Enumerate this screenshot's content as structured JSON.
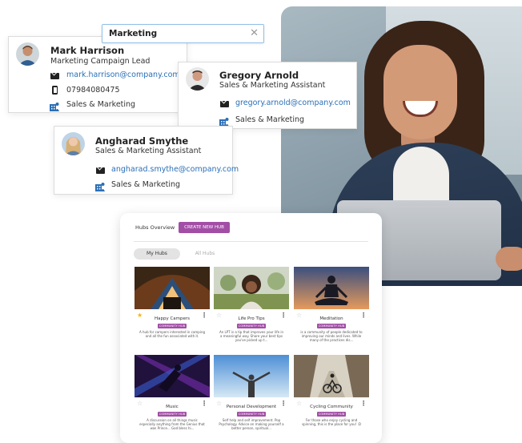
{
  "search": {
    "value": "Marketing"
  },
  "contacts": [
    {
      "name": "Mark Harrison",
      "role": "Marketing Campaign Lead",
      "email": "mark.harrison@company.com",
      "phone": "07984080475",
      "department": "Sales & Marketing"
    },
    {
      "name": "Gregory Arnold",
      "role": "Sales & Marketing Assistant",
      "email": "gregory.arnold@company.com",
      "department": "Sales & Marketing"
    },
    {
      "name": "Angharad Smythe",
      "role": "Sales & Marketing Assistant",
      "email": "angharad.smythe@company.com",
      "department": "Sales & Marketing"
    }
  ],
  "hubs": {
    "title": "Hubs Overview",
    "create_label": "CREATE NEW HUB",
    "tabs": [
      "My Hubs",
      "All Hubs"
    ],
    "badge_label": "COMMUNITY HUB",
    "items": [
      {
        "name": "Happy Campers",
        "desc": "A hub for campers interested in camping and all the fun associated with it.",
        "starred": true
      },
      {
        "name": "Life Pro Tips",
        "desc": "An LPT is a tip that improves your life in a meaningful way. Share your best tips you've picked up t...",
        "starred": false
      },
      {
        "name": "Meditation",
        "desc": "is a community of people dedicated to improving our minds and lives. While many of the practices dis...",
        "starred": false
      },
      {
        "name": "Music",
        "desc": "A discussion on all things music especially anything from the Genius that was Prince... God bless hi...",
        "starred": false
      },
      {
        "name": "Personal Development",
        "desc": "Self help and self improvement. Pop Psychology. Advice on making yourself a better person, spiritual...",
        "starred": false
      },
      {
        "name": "Cycling Community",
        "desc": "For those who enjoy cycling and spinning, this is the place for you! :D",
        "starred": false
      }
    ]
  },
  "colors": {
    "accent": "#a24ea6",
    "link": "#2a6fb7",
    "star": "#f2b51a"
  }
}
